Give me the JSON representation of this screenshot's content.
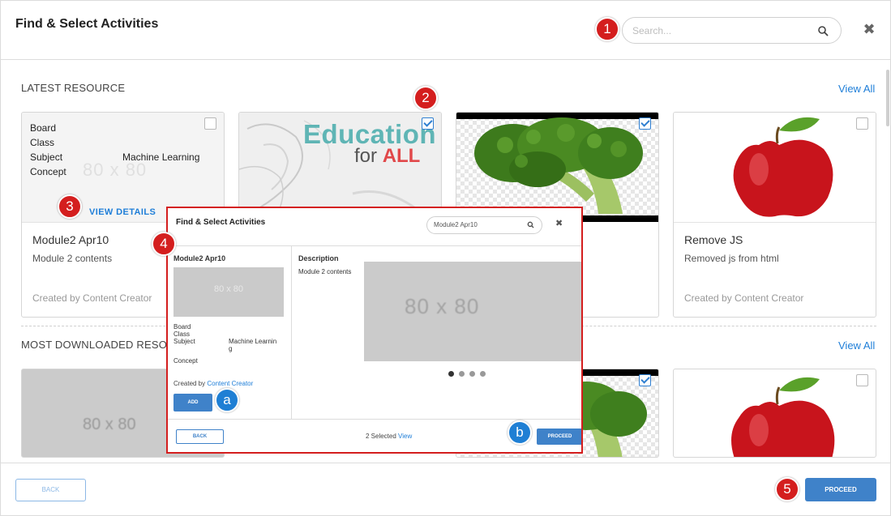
{
  "header": {
    "title": "Find & Select Activities",
    "search_placeholder": "Search...",
    "close_glyph": "✖"
  },
  "latest": {
    "heading": "LATEST RESOURCE",
    "view_all": "View All",
    "cards": [
      {
        "meta": {
          "board_label": "Board",
          "class_label": "Class",
          "subject_label": "Subject",
          "subject_value": "Machine Learning",
          "concept_label": "Concept"
        },
        "placeholder": "80 x 80",
        "view_details": "VIEW DETAILS",
        "title": "Module2 Apr10",
        "description": "Module 2 contents",
        "creator": "Created by Content Creator",
        "checked": false
      },
      {
        "image_text_1": "Education",
        "image_text_2": "for",
        "image_text_3": "ALL",
        "checked": true
      },
      {
        "image": "broccoli",
        "checked": true
      },
      {
        "title": "Remove JS",
        "description": "Removed js from html",
        "creator": "Created by Content Creator",
        "image": "apple",
        "checked": false
      }
    ]
  },
  "most_downloaded": {
    "heading": "MOST DOWNLOADED RESOU",
    "view_all": "View All",
    "cards": [
      {
        "placeholder": "80 x 80"
      },
      {
        "image": "broccoli",
        "checked": true
      },
      {
        "image": "apple",
        "checked": false
      }
    ]
  },
  "popup": {
    "title": "Find & Select Activities",
    "search_value": "Module2 Apr10",
    "close_glyph": "✖",
    "item_name": "Module2 Apr10",
    "thumb_placeholder": "80 x 80",
    "meta": {
      "board_label": "Board",
      "class_label": "Class",
      "subject_label": "Subject",
      "subject_value": "Machine Learnin",
      "subject_value_wrap": "g",
      "concept_label": "Concept"
    },
    "created_by_prefix": "Created by ",
    "created_by_link": "Content Creator",
    "add_label": "ADD",
    "description_label": "Description",
    "description_text": "Module 2 contents",
    "big_placeholder": "80 x 80",
    "carousel": {
      "count": 4,
      "active": 0
    },
    "back_label": "BACK",
    "selected_text": "2 Selected ",
    "selected_link": "View",
    "proceed_label": "PROCEED"
  },
  "footer": {
    "back_label": "BACK",
    "proceed_label": "PROCEED"
  },
  "markers": {
    "m1": "1",
    "m2": "2",
    "m3": "3",
    "m4": "4",
    "m5": "5",
    "ma": "a",
    "mb": "b"
  },
  "colors": {
    "accent": "#3f82c9",
    "link": "#1e7ed8",
    "marker_red": "#d41e1e",
    "marker_blue": "#1f7fd4"
  }
}
